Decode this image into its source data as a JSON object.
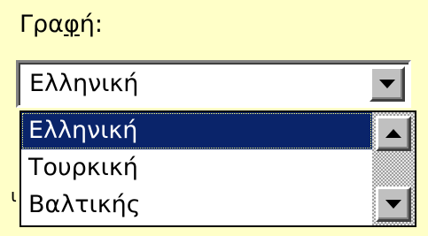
{
  "field": {
    "label": "Γραφή:",
    "label_accel_char": "φ",
    "label_before": "Γρα",
    "label_after": "ή:"
  },
  "combo": {
    "selected_value": "Ελληνική"
  },
  "dropdown": {
    "items": [
      {
        "label": "Ελληνική",
        "selected": true
      },
      {
        "label": "Τουρκική",
        "selected": false
      },
      {
        "label": "Βαλτικής",
        "selected": false
      }
    ]
  },
  "partial_text": "ι",
  "colors": {
    "background": "#ffffc8",
    "selection": "#0a246a",
    "button_face": "#c0c0c0"
  },
  "icons": {
    "combo_button": "chevron-down-icon",
    "scroll_up": "scroll-up-arrow-icon",
    "scroll_down": "scroll-down-arrow-icon"
  }
}
